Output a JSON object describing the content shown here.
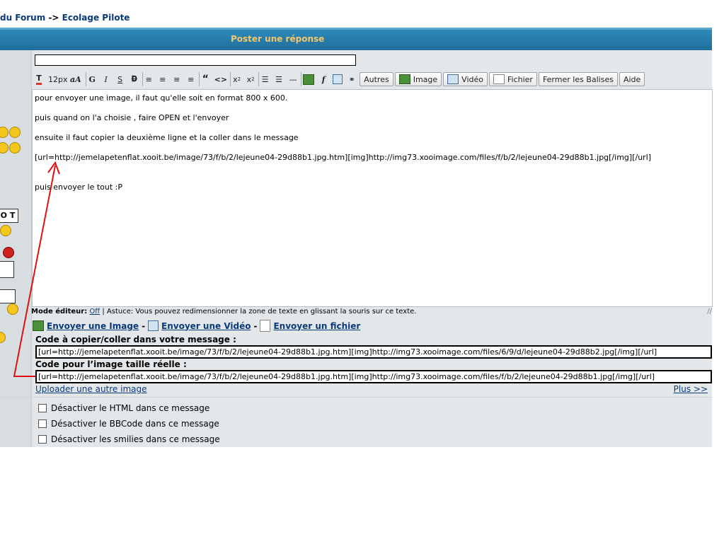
{
  "breadcrumb": {
    "forum": "du Forum",
    "sep": " -> ",
    "current": "Ecolage Pilote"
  },
  "header": {
    "title": "Poster une réponse"
  },
  "toolbar": {
    "font_size": "12px",
    "bold": "G",
    "italic": "I",
    "strike": "S",
    "autres": "Autres",
    "image": "Image",
    "video": "Vidéo",
    "fichier": "Fichier",
    "fermer": "Fermer les Balises",
    "aide": "Aide"
  },
  "message": {
    "line1": "pour envoyer une image, il faut qu'elle soit en format 800 x 600.",
    "line2": "puis quand on l'a choisie , faire OPEN et l'envoyer",
    "line3": "ensuite il faut copier la deuxième ligne et la coller dans le message",
    "line4": "[url=http://jemelapetenflat.xooit.be/image/73/f/b/2/lejeune04-29d88b1.jpg.htm][img]http://img73.xooimage.com/files/f/b/2/lejeune04-29d88b1.jpg[/img][/url]",
    "line5": "puis envoyer le tout   :P"
  },
  "modebar": {
    "label": "Mode éditeur:",
    "value": "Off",
    "tip": " | Astuce: Vous pouvez redimensionner la zone de texte en glissant la souris sur ce texte."
  },
  "send": {
    "image": "Envoyer une Image",
    "video": "Envoyer une Vidéo",
    "file": "Envoyer un fichier",
    "dash": "-"
  },
  "codes": {
    "copy_label": "Code à copier/coller dans votre message :",
    "copy_value": "[url=http://jemelapetenflat.xooit.be/image/73/f/b/2/lejeune04-29d88b1.jpg.htm][img]http://img73.xooimage.com/files/6/9/d/lejeune04-29d88b2.jpg[/img][/url]",
    "real_label": "Code pour l’image taille réelle :",
    "real_value": "[url=http://jemelapetenflat.xooit.be/image/73/f/b/2/lejeune04-29d88b1.jpg.htm][img]http://img73.xooimage.com/files/f/b/2/lejeune04-29d88b1.jpg[/img][/url]"
  },
  "links": {
    "upload": "Uploader une autre image",
    "plus": "Plus >>"
  },
  "options": [
    {
      "label": "Désactiver le HTML dans ce message"
    },
    {
      "label": "Désactiver le BBCode dans ce message"
    },
    {
      "label": "Désactiver les smilies dans ce message"
    }
  ],
  "colors": {
    "header": "#1f6e9d",
    "title": "#f5c66a",
    "link": "#0b3a7a",
    "arrow": "#e01010"
  },
  "left_badge": "O T"
}
